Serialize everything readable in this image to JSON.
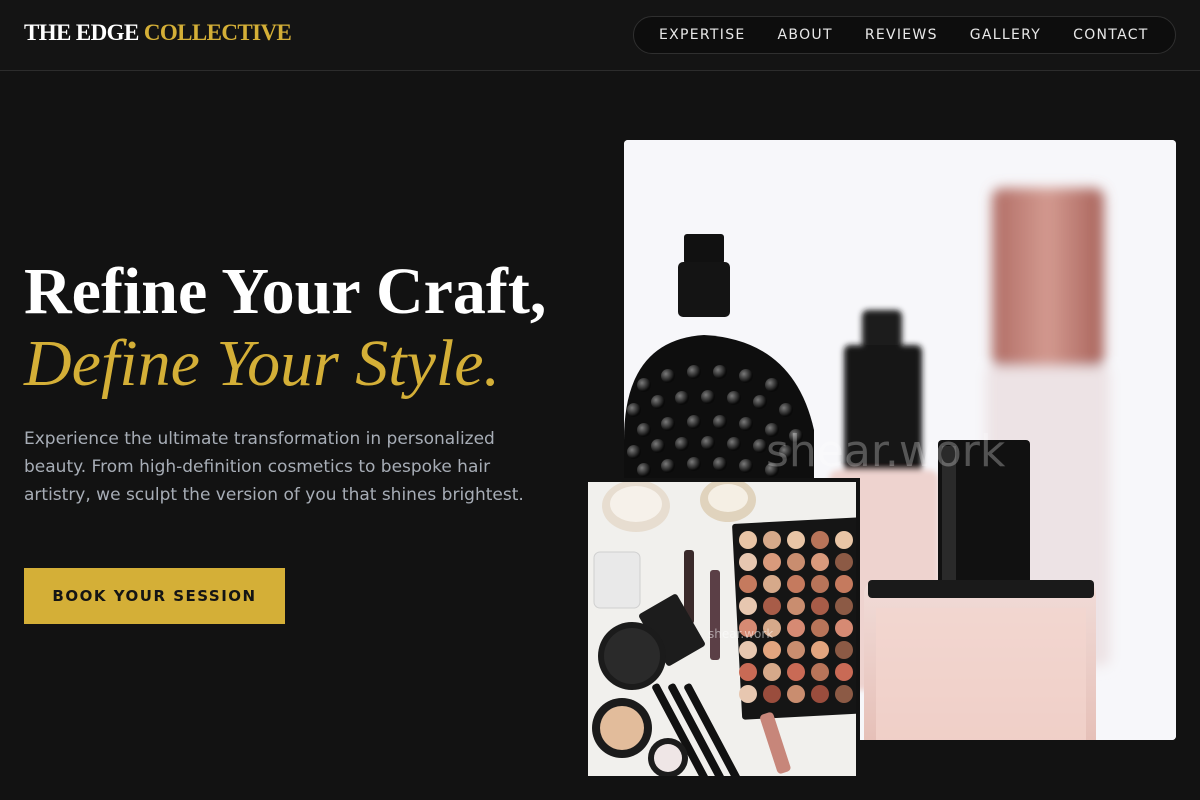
{
  "header": {
    "logo_part1": "THE EDGE",
    "logo_part2": "COLLECTIVE",
    "nav": [
      {
        "label": "EXPERTISE"
      },
      {
        "label": "ABOUT"
      },
      {
        "label": "REVIEWS"
      },
      {
        "label": "GALLERY"
      },
      {
        "label": "CONTACT"
      }
    ]
  },
  "hero": {
    "headline_line1": "Refine Your Craft,",
    "headline_line2": "Define Your Style.",
    "description": "Experience the ultimate transformation in personalized beauty. From high-definition cosmetics to bespoke hair artistry, we sculpt the version of you that shines brightest.",
    "cta_label": "BOOK YOUR SESSION"
  },
  "images": {
    "main_watermark": "shear.work",
    "small_watermark": "shear.work"
  },
  "colors": {
    "background": "#121212",
    "accent": "#d4af37",
    "muted_text": "#a7adb6"
  }
}
